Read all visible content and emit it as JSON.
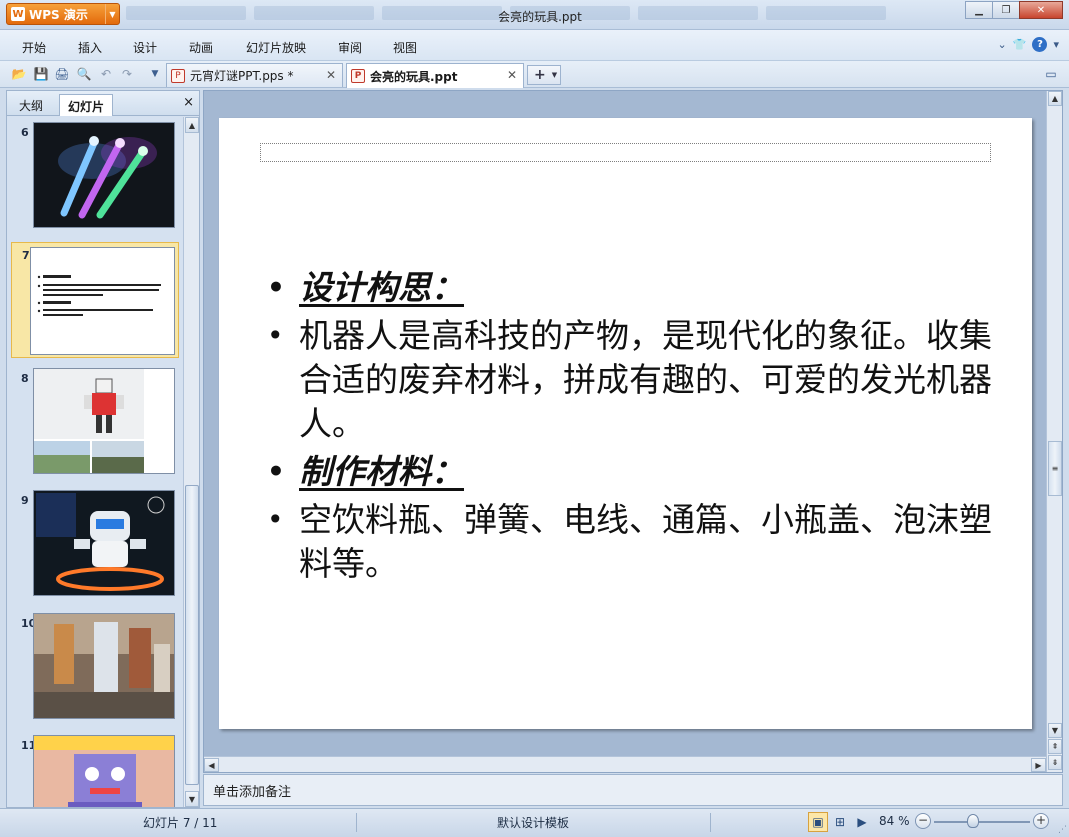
{
  "app": {
    "brand_label": "WPS 演示",
    "window_title": "会亮的玩具.ppt"
  },
  "menu": {
    "items": [
      "开始",
      "插入",
      "设计",
      "动画",
      "幻灯片放映",
      "审阅",
      "视图"
    ]
  },
  "doc_tabs": [
    {
      "label": "元宵灯谜PPT.pps *",
      "active": false
    },
    {
      "label": "会亮的玩具.ppt",
      "active": true
    }
  ],
  "left_panel": {
    "tabs": [
      "大纲",
      "幻灯片"
    ],
    "active_tab": "幻灯片",
    "close_symbol": "×",
    "slides": [
      {
        "number": "6",
        "selected": false
      },
      {
        "number": "7",
        "selected": true
      },
      {
        "number": "8",
        "selected": false
      },
      {
        "number": "9",
        "selected": false
      },
      {
        "number": "10",
        "selected": false
      },
      {
        "number": "11",
        "selected": false
      }
    ]
  },
  "slide": {
    "heading1": "设计构思：",
    "text1": "机器人是高科技的产物，是现代化的象征。收集合适的废弃材料，拼成有趣的、可爱的发光机器人。",
    "heading2": "制作材料：",
    "text2": "空饮料瓶、弹簧、电线、通篇、小瓶盖、泡沫塑料等。"
  },
  "notes": {
    "placeholder": "单击添加备注"
  },
  "status": {
    "slide_counter": "幻灯片 7 / 11",
    "template": "默认设计模板",
    "zoom": "84 %"
  }
}
